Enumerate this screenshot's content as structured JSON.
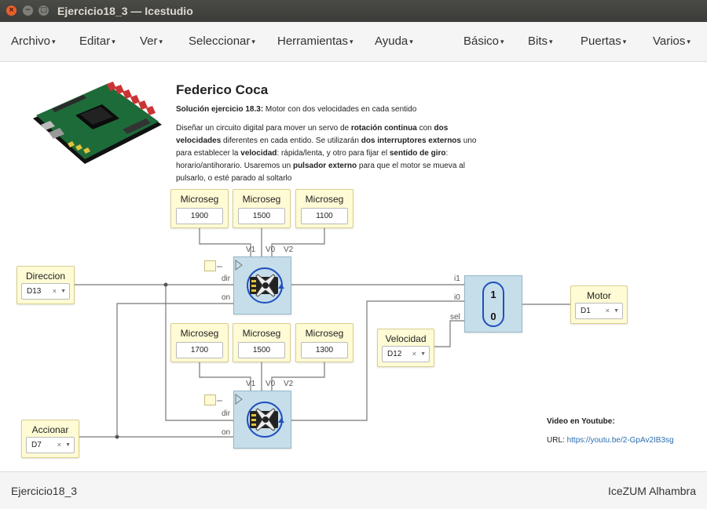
{
  "window": {
    "title": "Ejercicio18_3 — Icestudio",
    "close_glyph": "×",
    "min_glyph": "−",
    "max_glyph": "□"
  },
  "menu": {
    "left": [
      "Archivo",
      "Editar",
      "Ver",
      "Seleccionar",
      "Herramientas",
      "Ayuda"
    ],
    "right": [
      "Básico",
      "Bits",
      "Puertas",
      "Varios"
    ]
  },
  "doc": {
    "title": "Federico Coca",
    "subtitle_bold": "Solución ejercicio 18.3:",
    "subtitle_rest": " Motor con dos velocidades en cada sentido",
    "body": [
      {
        "t": "Diseñar un circuito digital para mover un servo de ",
        "b": false
      },
      {
        "t": "rotación continua",
        "b": true
      },
      {
        "t": " con ",
        "b": false
      },
      {
        "t": "dos velocidades",
        "b": true
      },
      {
        "t": " diferentes en cada entido. Se utilizarán ",
        "b": false
      },
      {
        "t": "dos interruptores externos",
        "b": true
      },
      {
        "t": " uno para establecer la ",
        "b": false
      },
      {
        "t": "velocidad",
        "b": true
      },
      {
        "t": ": rápida/lenta, y otro para fijar el ",
        "b": false
      },
      {
        "t": "sentido de giro",
        "b": true
      },
      {
        "t": ": horario/antihorario. Usaremos un ",
        "b": false
      },
      {
        "t": "pulsador externo",
        "b": true
      },
      {
        "t": " para que el motor se mueva al pulsarlo, o esté parado al soltarlo",
        "b": false
      }
    ]
  },
  "blocks": {
    "const_top": [
      {
        "label": "Microseg",
        "value": "1900"
      },
      {
        "label": "Microseg",
        "value": "1500"
      },
      {
        "label": "Microseg",
        "value": "1100"
      }
    ],
    "const_bottom": [
      {
        "label": "Microseg",
        "value": "1700"
      },
      {
        "label": "Microseg",
        "value": "1500"
      },
      {
        "label": "Microseg",
        "value": "1300"
      }
    ],
    "servo_ports": {
      "v1": "V1",
      "v0": "V0",
      "v2": "V2",
      "dir": "dir",
      "on": "on"
    },
    "inputs": [
      {
        "label": "Direccion",
        "value": "D13"
      },
      {
        "label": "Accionar",
        "value": "D7"
      },
      {
        "label": "Velocidad",
        "value": "D12"
      }
    ],
    "output": {
      "label": "Motor",
      "value": "D1"
    },
    "mux": {
      "i1": "i1",
      "i0": "i0",
      "sel": "sel",
      "one": "1",
      "zero": "0"
    },
    "select_clear": "×",
    "select_caret": "▼"
  },
  "video": {
    "title": "Video en Youtube:",
    "url_label": "URL:",
    "url": "https://youtu.be/2-GpAv2IB3sg"
  },
  "status": {
    "left": "Ejercicio18_3",
    "right": "IceZUM Alhambra"
  },
  "colors": {
    "wire": "#777777",
    "servo_block": "#c6deea",
    "const_block": "#fffbd5",
    "mux_pill": "#1f4fbf",
    "link": "#2a6fb0"
  }
}
